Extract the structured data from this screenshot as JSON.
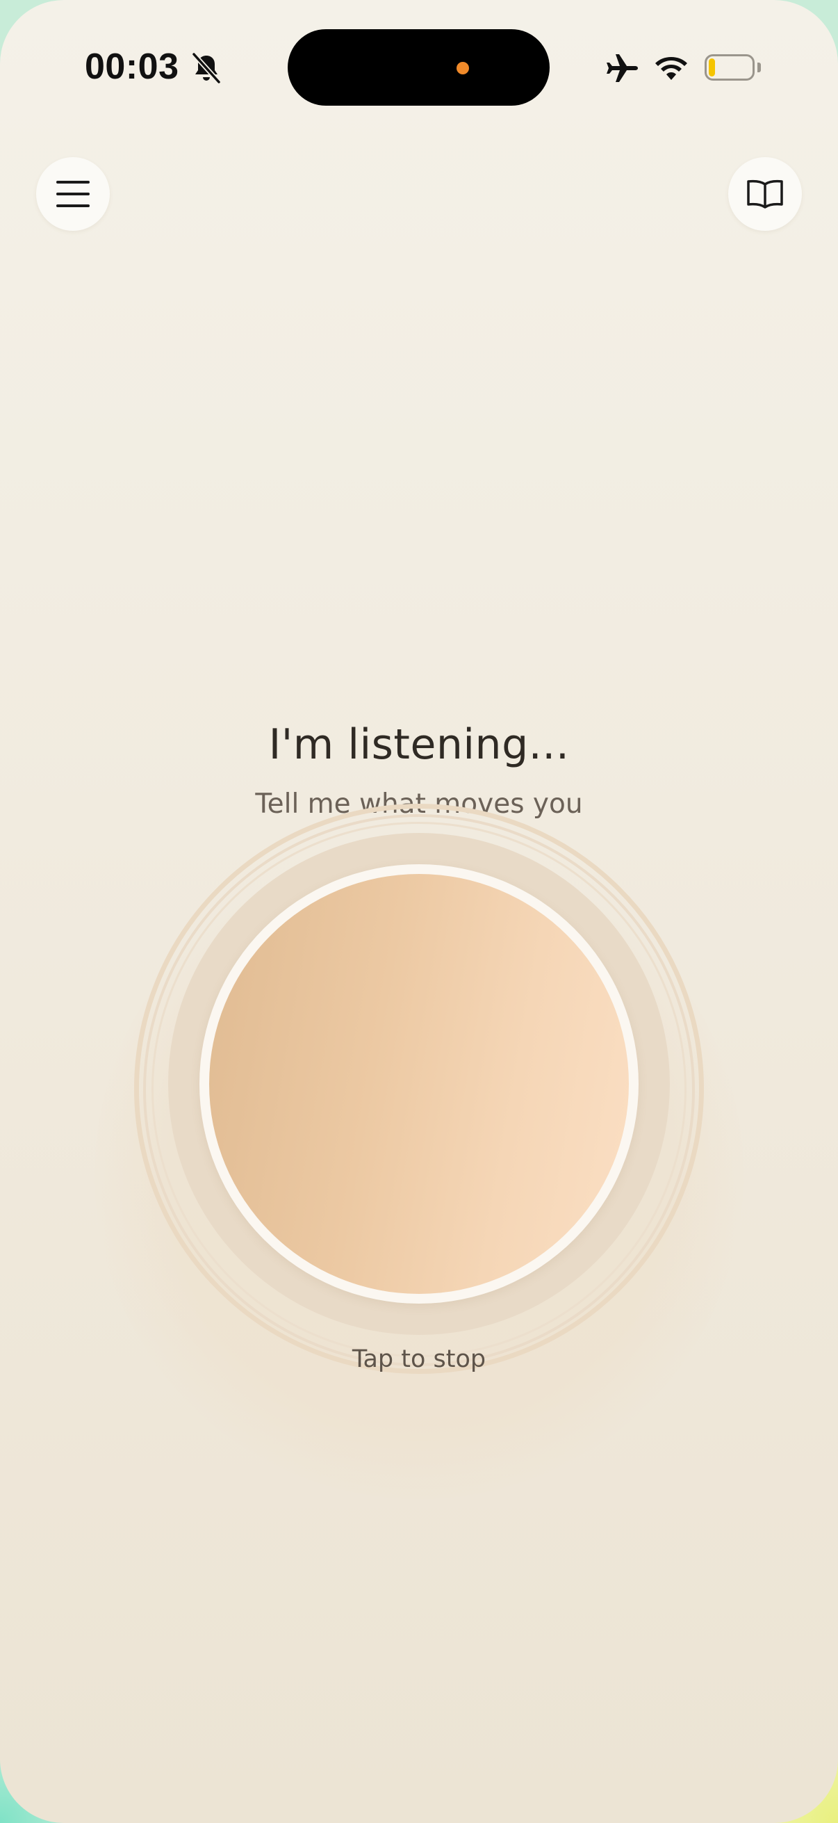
{
  "status_bar": {
    "time": "00:03",
    "icons": [
      "bell-slash-icon",
      "airplane-icon",
      "wifi-icon",
      "battery-icon"
    ],
    "battery_level": 0.15,
    "battery_color": "#f5c400",
    "island_indicator_color": "#f08a2a"
  },
  "header": {
    "menu_icon": "hamburger-menu-icon",
    "journal_icon": "open-book-icon"
  },
  "listening": {
    "title": "I'm listening...",
    "subtitle": "Tell me what moves you",
    "hint": "Tap to stop"
  },
  "colors": {
    "background_top": "#f4f1e8",
    "background_bottom": "#ece4d4",
    "orb_left": "#e0bb92",
    "orb_right": "#fbdfc4",
    "title_text": "#2f2a24"
  }
}
